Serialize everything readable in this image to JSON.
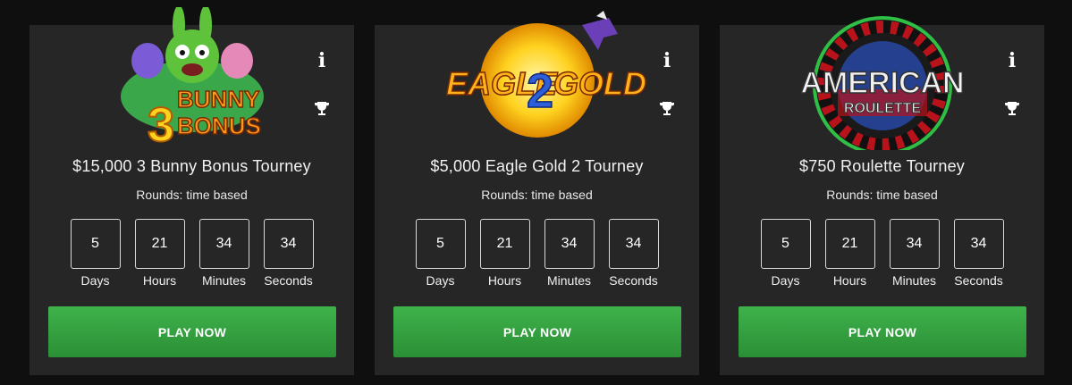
{
  "cards": [
    {
      "logo": {
        "line1": "3",
        "line2": "BUNNY",
        "line3": "BONUS"
      },
      "title": "$15,000 3 Bunny Bonus Tourney",
      "rounds": "Rounds: time based",
      "countdown": {
        "days": "5",
        "hours": "21",
        "minutes": "34",
        "seconds": "34"
      },
      "labels": {
        "days": "Days",
        "hours": "Hours",
        "minutes": "Minutes",
        "seconds": "Seconds"
      },
      "play_label": "PLAY NOW"
    },
    {
      "logo": {
        "line1": "EAGLE",
        "line2": "2",
        "line3": "GOLD"
      },
      "title": "$5,000 Eagle Gold 2 Tourney",
      "rounds": "Rounds: time based",
      "countdown": {
        "days": "5",
        "hours": "21",
        "minutes": "34",
        "seconds": "34"
      },
      "labels": {
        "days": "Days",
        "hours": "Hours",
        "minutes": "Minutes",
        "seconds": "Seconds"
      },
      "play_label": "PLAY NOW"
    },
    {
      "logo": {
        "line1": "AMERICAN",
        "line2": "ROULETTE"
      },
      "title": "$750 Roulette Tourney",
      "rounds": "Rounds: time based",
      "countdown": {
        "days": "5",
        "hours": "21",
        "minutes": "34",
        "seconds": "34"
      },
      "labels": {
        "days": "Days",
        "hours": "Hours",
        "minutes": "Minutes",
        "seconds": "Seconds"
      },
      "play_label": "PLAY NOW"
    }
  ],
  "icons": {
    "info": "info-icon",
    "trophy": "trophy-icon"
  },
  "colors": {
    "background": "#0f0f0f",
    "card": "#262626",
    "play_button": "#34a23f"
  }
}
